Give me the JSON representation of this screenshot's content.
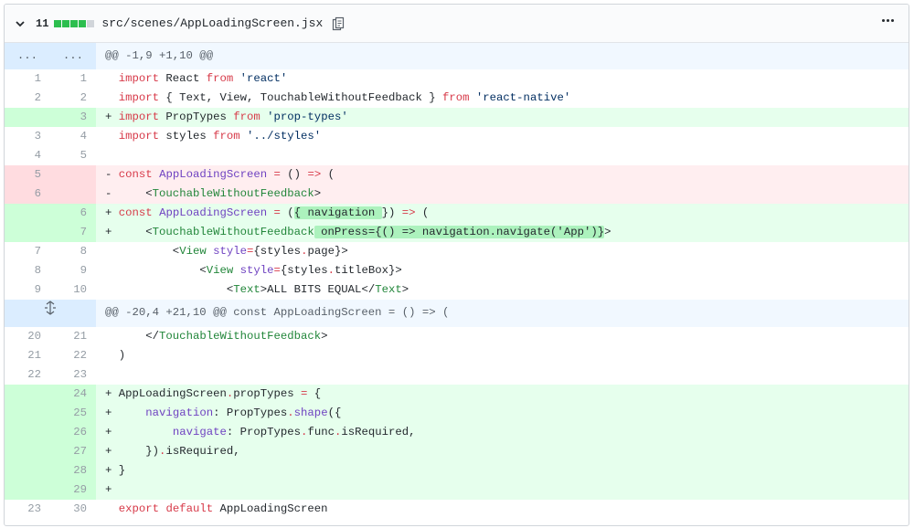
{
  "file": {
    "additions_count": "11",
    "path": "src/scenes/AppLoadingScreen.jsx",
    "diffstat": [
      "add",
      "add",
      "add",
      "add",
      "neutral"
    ]
  },
  "hunks": [
    {
      "header": "@@ -1,9 +1,10 @@",
      "left_marker": "...",
      "right_marker": "..."
    },
    {
      "header": "@@ -20,4 +21,10 @@ const AppLoadingScreen = () => ("
    }
  ],
  "lines": [
    {
      "old": "1",
      "new": "1",
      "sign": " ",
      "tokens": [
        [
          "k",
          "import"
        ],
        [
          "p",
          " React "
        ],
        [
          "k",
          "from"
        ],
        [
          "p",
          " "
        ],
        [
          "s",
          "'react'"
        ]
      ]
    },
    {
      "old": "2",
      "new": "2",
      "sign": " ",
      "tokens": [
        [
          "k",
          "import"
        ],
        [
          "p",
          " { Text, View, TouchableWithoutFeedback } "
        ],
        [
          "k",
          "from"
        ],
        [
          "p",
          " "
        ],
        [
          "s",
          "'react-native'"
        ]
      ]
    },
    {
      "old": "",
      "new": "3",
      "sign": "+",
      "tokens": [
        [
          "k",
          "import"
        ],
        [
          "p",
          " PropTypes "
        ],
        [
          "k",
          "from"
        ],
        [
          "p",
          " "
        ],
        [
          "s",
          "'prop-types'"
        ]
      ]
    },
    {
      "old": "3",
      "new": "4",
      "sign": " ",
      "tokens": [
        [
          "k",
          "import"
        ],
        [
          "p",
          " styles "
        ],
        [
          "k",
          "from"
        ],
        [
          "p",
          " "
        ],
        [
          "s",
          "'../styles'"
        ]
      ]
    },
    {
      "old": "4",
      "new": "5",
      "sign": " ",
      "tokens": []
    },
    {
      "old": "5",
      "new": "",
      "sign": "-",
      "tokens": [
        [
          "k",
          "const"
        ],
        [
          "p",
          " "
        ],
        [
          "e",
          "AppLoadingScreen"
        ],
        [
          "p",
          " "
        ],
        [
          "k",
          "="
        ],
        [
          "p",
          " () "
        ],
        [
          "k",
          "=>"
        ],
        [
          "p",
          " ("
        ]
      ]
    },
    {
      "old": "6",
      "new": "",
      "sign": "-",
      "tokens": [
        [
          "p",
          "    <"
        ],
        [
          "t",
          "TouchableWithoutFeedback"
        ],
        [
          "p",
          ">"
        ]
      ]
    },
    {
      "old": "",
      "new": "6",
      "sign": "+",
      "tokens": [
        [
          "k",
          "const"
        ],
        [
          "p",
          " "
        ],
        [
          "e",
          "AppLoadingScreen"
        ],
        [
          "p",
          " "
        ],
        [
          "k",
          "="
        ],
        [
          "p",
          " ("
        ],
        [
          "pw",
          "{ navigation "
        ],
        [
          "p",
          "}) "
        ],
        [
          "k",
          "=>"
        ],
        [
          "p",
          " ("
        ]
      ]
    },
    {
      "old": "",
      "new": "7",
      "sign": "+",
      "tokens": [
        [
          "p",
          "    <"
        ],
        [
          "t",
          "TouchableWithoutFeedback"
        ],
        [
          "pw",
          " onPress={() => navigation.navigate('App')}"
        ],
        [
          "p",
          ">"
        ]
      ]
    },
    {
      "old": "7",
      "new": "8",
      "sign": " ",
      "tokens": [
        [
          "p",
          "        <"
        ],
        [
          "t",
          "View"
        ],
        [
          "p",
          " "
        ],
        [
          "a",
          "style"
        ],
        [
          "k",
          "="
        ],
        [
          "p",
          "{styles"
        ],
        [
          "k",
          "."
        ],
        [
          "p",
          "page}>"
        ]
      ]
    },
    {
      "old": "8",
      "new": "9",
      "sign": " ",
      "tokens": [
        [
          "p",
          "            <"
        ],
        [
          "t",
          "View"
        ],
        [
          "p",
          " "
        ],
        [
          "a",
          "style"
        ],
        [
          "k",
          "="
        ],
        [
          "p",
          "{styles"
        ],
        [
          "k",
          "."
        ],
        [
          "p",
          "titleBox}>"
        ]
      ]
    },
    {
      "old": "9",
      "new": "10",
      "sign": " ",
      "tokens": [
        [
          "p",
          "                <"
        ],
        [
          "t",
          "Text"
        ],
        [
          "p",
          ">ALL BITS EQUAL</"
        ],
        [
          "t",
          "Text"
        ],
        [
          "p",
          ">"
        ]
      ]
    },
    {
      "hunk": 1
    },
    {
      "old": "20",
      "new": "21",
      "sign": " ",
      "tokens": [
        [
          "p",
          "    </"
        ],
        [
          "t",
          "TouchableWithoutFeedback"
        ],
        [
          "p",
          ">"
        ]
      ]
    },
    {
      "old": "21",
      "new": "22",
      "sign": " ",
      "tokens": [
        [
          "p",
          ")"
        ]
      ]
    },
    {
      "old": "22",
      "new": "23",
      "sign": " ",
      "tokens": []
    },
    {
      "old": "",
      "new": "24",
      "sign": "+",
      "tokens": [
        [
          "p",
          "AppLoadingScreen"
        ],
        [
          "k",
          "."
        ],
        [
          "p",
          "propTypes "
        ],
        [
          "k",
          "="
        ],
        [
          "p",
          " {"
        ]
      ]
    },
    {
      "old": "",
      "new": "25",
      "sign": "+",
      "tokens": [
        [
          "p",
          "    "
        ],
        [
          "a",
          "navigation"
        ],
        [
          "p",
          ": PropTypes"
        ],
        [
          "k",
          "."
        ],
        [
          "e",
          "shape"
        ],
        [
          "p",
          "({"
        ]
      ]
    },
    {
      "old": "",
      "new": "26",
      "sign": "+",
      "tokens": [
        [
          "p",
          "        "
        ],
        [
          "a",
          "navigate"
        ],
        [
          "p",
          ": PropTypes"
        ],
        [
          "k",
          "."
        ],
        [
          "p",
          "func"
        ],
        [
          "k",
          "."
        ],
        [
          "p",
          "isRequired,"
        ]
      ]
    },
    {
      "old": "",
      "new": "27",
      "sign": "+",
      "tokens": [
        [
          "p",
          "    })"
        ],
        [
          "k",
          "."
        ],
        [
          "p",
          "isRequired,"
        ]
      ]
    },
    {
      "old": "",
      "new": "28",
      "sign": "+",
      "tokens": [
        [
          "p",
          "}"
        ]
      ]
    },
    {
      "old": "",
      "new": "29",
      "sign": "+",
      "tokens": []
    },
    {
      "old": "23",
      "new": "30",
      "sign": " ",
      "tokens": [
        [
          "k",
          "export"
        ],
        [
          "p",
          " "
        ],
        [
          "k",
          "default"
        ],
        [
          "p",
          " AppLoadingScreen"
        ]
      ]
    }
  ]
}
